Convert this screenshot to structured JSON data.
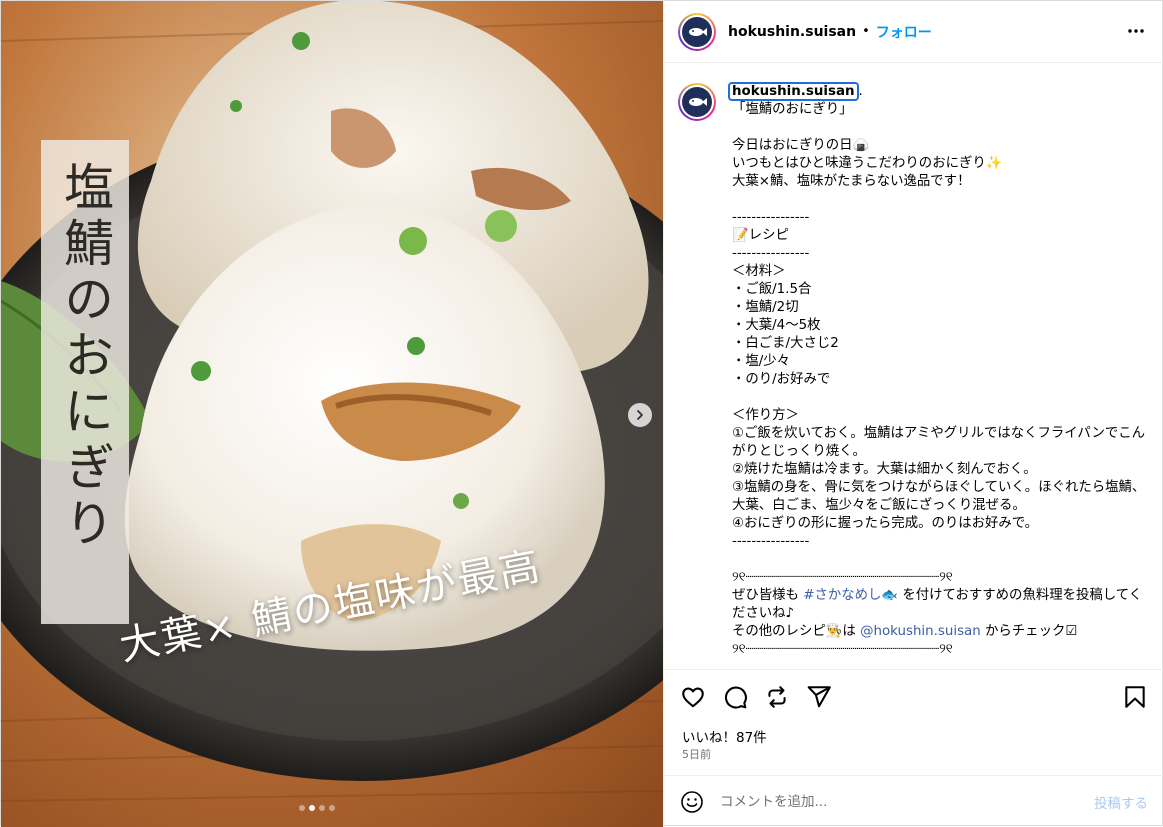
{
  "media": {
    "title_vertical": "塩鯖のおにぎり",
    "subtitle": "大葉× 鯖の塩味が最高",
    "dots_count": 4,
    "active_dot": 1
  },
  "header": {
    "username": "hokushin.suisan",
    "separator": "•",
    "follow_label": "フォロー",
    "more_icon": "more-horizontal-icon"
  },
  "caption": {
    "username": "hokushin.suisan",
    "lines": {
      "l01": "「塩鯖のおにぎり」",
      "l02": "",
      "l03": "今日はおにぎりの日🍙",
      "l04": "いつもとはひと味違うこだわりのおにぎり✨",
      "l05": "大葉×鯖、塩味がたまらない逸品です！",
      "l06": "",
      "l07": "----------------",
      "l08": "📝レシピ",
      "l09": "----------------",
      "l10": "＜材料＞",
      "l11": "・ご飯/1.5合",
      "l12": "・塩鯖/2切",
      "l13": "・大葉/4〜5枚",
      "l14": "・白ごま/大さじ2",
      "l15": "・塩/少々",
      "l16": "・のり/お好みで",
      "l17": "",
      "l18": "＜作り方＞",
      "l19": "①ご飯を炊いておく。塩鯖はアミやグリルではなくフライパンでこんがりとじっくり焼く。",
      "l20": "②焼けた塩鯖は冷ます。大葉は細かく刻んでおく。",
      "l21": "③塩鯖の身を、骨に気をつけながらほぐしていく。ほぐれたら塩鯖、大葉、白ごま、塩少々をご飯にざっくり混ぜる。",
      "l22": "④おにぎりの形に握ったら完成。のりはお好みで。",
      "l23": "----------------",
      "l24": "",
      "l25": "୨୧┈┈┈┈┈┈┈┈┈┈┈┈┈┈┈┈┈┈┈┈┈┈┈┈୨୧",
      "l26a": "ぜひ皆様も ",
      "l26b": "#さかなめし🐟",
      "l26c": " を付けておすすめの魚料理を投稿してくださいね♪",
      "l27a": "その他のレシピ👨‍🍳は ",
      "l27b": "@hokushin.suisan",
      "l27c": " からチェック☑",
      "l28": "୨୧┈┈┈┈┈┈┈┈┈┈┈┈┈┈┈┈┈┈┈┈┈┈┈┈୨୧"
    }
  },
  "actions": {
    "likes": "いいね！87件",
    "time": "5日前"
  },
  "comment": {
    "placeholder": "コメントを追加...",
    "post_label": "投稿する"
  },
  "colors": {
    "link": "#0095f6",
    "post_disabled": "#a8c8f0"
  }
}
